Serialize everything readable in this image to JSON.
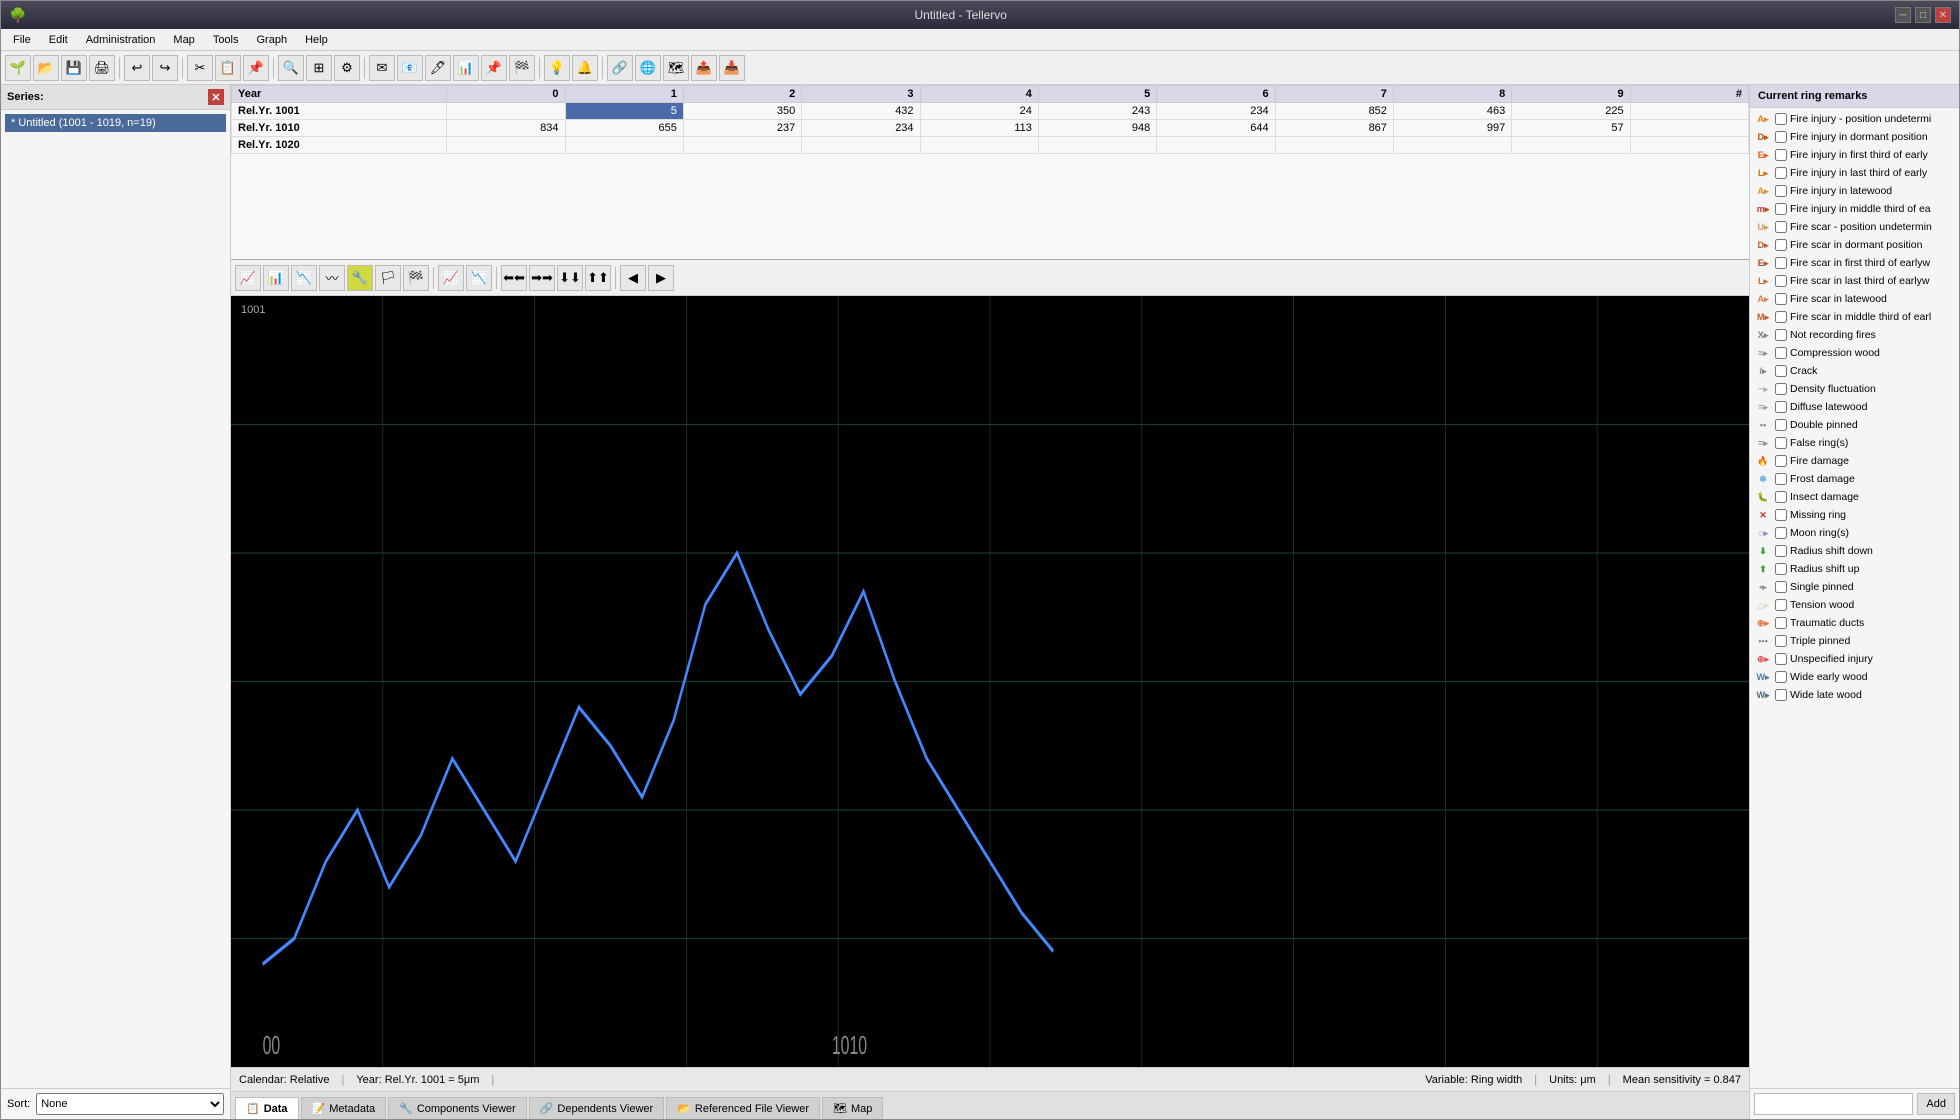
{
  "app": {
    "title": "Untitled - Tellervo",
    "controls": [
      "─",
      "□",
      "✕"
    ]
  },
  "menu": {
    "items": [
      "File",
      "Edit",
      "Administration",
      "Map",
      "Tools",
      "Graph",
      "Help"
    ]
  },
  "toolbar": {
    "buttons": [
      "📂",
      "💾",
      "🖨",
      "↩",
      "↪",
      "✂",
      "📋",
      "🔍",
      "⚙",
      "🔎",
      "✉",
      "📧",
      "🖊",
      "📊",
      "📌",
      "🎯",
      "💡",
      "🔔",
      "⚡",
      "🔗",
      "🌐",
      "🗺",
      "📤",
      "📥"
    ]
  },
  "series": {
    "label": "Series:",
    "close_label": "✕",
    "items": [
      {
        "label": "* Untitled (1001 - 1019, n=19)"
      }
    ]
  },
  "sort": {
    "label": "Sort:",
    "options": [
      "None"
    ],
    "selected": "None"
  },
  "data_table": {
    "columns": [
      "Year",
      "0",
      "1",
      "2",
      "3",
      "4",
      "5",
      "6",
      "7",
      "8",
      "9",
      "#"
    ],
    "rows": [
      {
        "label": "Rel.Yr. 1001",
        "values": [
          "",
          "5",
          "350",
          "432",
          "24",
          "243",
          "234",
          "852",
          "463",
          "225",
          ""
        ],
        "selected_col": 1
      },
      {
        "label": "Rel.Yr. 1010",
        "values": [
          "834",
          "655",
          "237",
          "234",
          "113",
          "948",
          "644",
          "867",
          "997",
          "57",
          ""
        ]
      },
      {
        "label": "Rel.Yr. 1020",
        "values": [
          "",
          "",
          "",
          "",
          "",
          "",
          "",
          "",
          "",
          "",
          ""
        ]
      }
    ]
  },
  "chart_toolbar": {
    "buttons": [
      "📈",
      "📊",
      "📉",
      "〰",
      "🔧",
      "🏳",
      "🏁",
      "📈",
      "📉",
      "⬅",
      "➡",
      "⬇",
      "⬆",
      "←",
      "→"
    ]
  },
  "chart": {
    "label": "1001",
    "x_labels": [
      "00",
      "1010"
    ],
    "line_color": "#4488ff"
  },
  "status_bar": {
    "calendar": "Calendar: Relative",
    "year": "Year: Rel.Yr. 1001 = 5μm",
    "variable": "Variable: Ring width",
    "units": "Units: μm",
    "sensitivity": "Mean sensitivity = 0.847"
  },
  "tabs": [
    {
      "label": "Data",
      "active": true,
      "icon": "📋"
    },
    {
      "label": "Metadata",
      "active": false,
      "icon": "📝"
    },
    {
      "label": "Components Viewer",
      "active": false,
      "icon": "🔧"
    },
    {
      "label": "Dependents Viewer",
      "active": false,
      "icon": "🔗"
    },
    {
      "label": "Referenced File Viewer",
      "active": false,
      "icon": "📂"
    },
    {
      "label": "Map",
      "active": false,
      "icon": "🗺"
    }
  ],
  "remarks": {
    "header": "Current ring remarks",
    "items": [
      {
        "icon_color": "#e08020",
        "icon_text": "A▸",
        "label": "Fire injury - position undetermi"
      },
      {
        "icon_color": "#c05010",
        "icon_text": "D▸",
        "label": "Fire injury in dormant position"
      },
      {
        "icon_color": "#e06010",
        "icon_text": "E▸",
        "label": "Fire injury in first third of early"
      },
      {
        "icon_color": "#d07010",
        "icon_text": "L▸",
        "label": "Fire injury in last third of early"
      },
      {
        "icon_color": "#e09030",
        "icon_text": "A▸",
        "label": "Fire injury in latewood"
      },
      {
        "icon_color": "#c04020",
        "icon_text": "m▸",
        "label": "Fire injury in middle third of ea"
      },
      {
        "icon_color": "#d0a050",
        "icon_text": "U▸",
        "label": "Fire scar - position undetermin"
      },
      {
        "icon_color": "#c06030",
        "icon_text": "D▸",
        "label": "Fire scar in dormant position"
      },
      {
        "icon_color": "#b05020",
        "icon_text": "E▸",
        "label": "Fire scar in first third of earlyw"
      },
      {
        "icon_color": "#c07030",
        "icon_text": "L▸",
        "label": "Fire scar in last third of earlyw"
      },
      {
        "icon_color": "#d08040",
        "icon_text": "A▸",
        "label": "Fire scar in latewood"
      },
      {
        "icon_color": "#c06020",
        "icon_text": "M▸",
        "label": "Fire scar in middle third of earl"
      },
      {
        "icon_color": "#808080",
        "icon_text": "X▸",
        "label": "Not recording fires"
      },
      {
        "icon_color": "#9090a0",
        "icon_text": "≈▸",
        "label": "Compression wood"
      },
      {
        "icon_color": "#808080",
        "icon_text": "/▸",
        "label": "Crack"
      },
      {
        "icon_color": "#b0b0b0",
        "icon_text": "~▸",
        "label": "Density fluctuation"
      },
      {
        "icon_color": "#a0a0b0",
        "icon_text": "=▸",
        "label": "Diffuse latewood"
      },
      {
        "icon_color": "#8090a0",
        "icon_text": "••",
        "label": "Double pinned"
      },
      {
        "icon_color": "#909090",
        "icon_text": "=▸",
        "label": "False ring(s)"
      },
      {
        "icon_color": "#e04030",
        "icon_text": "🔥",
        "label": "Fire damage"
      },
      {
        "icon_color": "#60b0e0",
        "icon_text": "❄",
        "label": "Frost damage"
      },
      {
        "icon_color": "#c04040",
        "icon_text": "🐛",
        "label": "Insect damage"
      },
      {
        "icon_color": "#c03030",
        "icon_text": "✕",
        "label": "Missing ring"
      },
      {
        "icon_color": "#8090c0",
        "icon_text": "○▸",
        "label": "Moon ring(s)"
      },
      {
        "icon_color": "#40a040",
        "icon_text": "⬇",
        "label": "Radius shift down"
      },
      {
        "icon_color": "#40a040",
        "icon_text": "⬆",
        "label": "Radius shift up"
      },
      {
        "icon_color": "#909090",
        "icon_text": "•▸",
        "label": "Single pinned"
      },
      {
        "icon_color": "#b0904040",
        "icon_text": "△▸",
        "label": "Tension wood"
      },
      {
        "icon_color": "#e07030",
        "icon_text": "⊕▸",
        "label": "Traumatic ducts"
      },
      {
        "icon_color": "#8090a0",
        "icon_text": "•••",
        "label": "Triple pinned"
      },
      {
        "icon_color": "#e05050",
        "icon_text": "⊕▸",
        "label": "Unspecified injury"
      },
      {
        "icon_color": "#5080a0",
        "icon_text": "W▸",
        "label": "Wide early wood"
      },
      {
        "icon_color": "#507080",
        "icon_text": "W▸",
        "label": "Wide late wood"
      }
    ],
    "add_placeholder": "",
    "add_btn_label": "Add"
  }
}
